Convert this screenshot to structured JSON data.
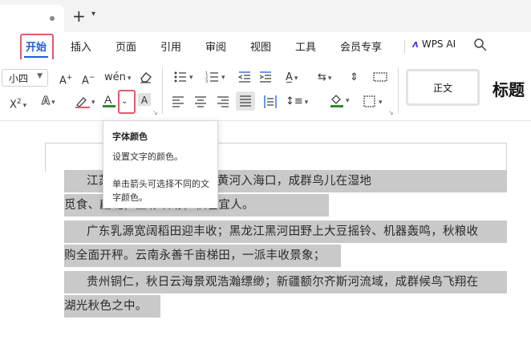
{
  "tabbar": {
    "new_tab_symbol": "+",
    "dropdown_symbol": "⌄"
  },
  "menu": {
    "items": [
      "开始",
      "插入",
      "页面",
      "引用",
      "审阅",
      "视图",
      "工具",
      "会员专享"
    ],
    "active": "开始",
    "wps_ai": "WPS AI",
    "accent_color": "#1c5fd9",
    "highlight_color": "#e35a6e"
  },
  "ribbon": {
    "font_size": "小四",
    "styles": {
      "normal": "正文",
      "title": "标题"
    },
    "font_color_swatch": "#2e8b2e",
    "highlight_swatch": "#2e8b2e"
  },
  "tooltip": {
    "title": "字体颜色",
    "desc": "设置文字的颜色。",
    "hint": "单击箭头可选择不同的文字颜色。"
  },
  "document": {
    "lines": [
      "江苏太湖相映成趣；山东黄河入海口，成群鸟儿在湿地",
      "觅食、翩跹，五彩缤纷，秋色宜人。",
      "广东乳源宽阔稻田迎丰收；黑龙江黑河田野上大豆摇铃、机器轰鸣，秋粮收",
      "购全面开秤。云南永善千亩梯田，一派丰收景象；",
      "贵州铜仁，秋日云海景观浩瀚缥缈；新疆额尔齐斯河流域，成群候鸟飞翔在",
      "湖光秋色之中。"
    ],
    "selection_color": "#c9c9c9"
  }
}
